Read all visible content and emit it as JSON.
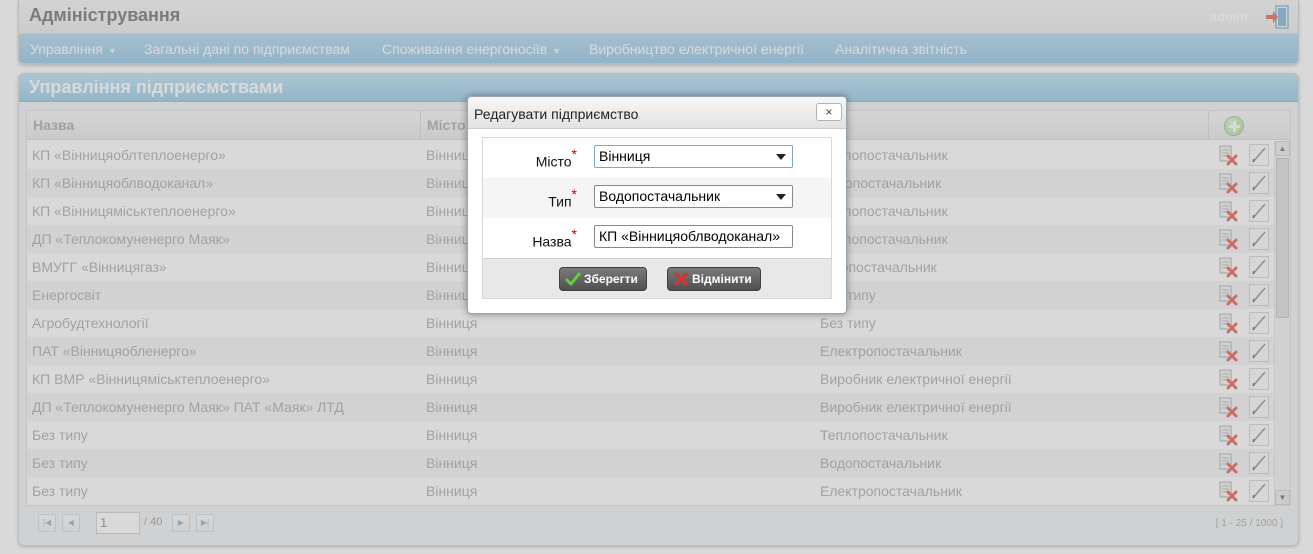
{
  "header": {
    "title": "Адміністрування",
    "user": "admin",
    "nav": [
      {
        "label": "Управління",
        "dropdown": true
      },
      {
        "label": "Загальні дані по підприємствам",
        "dropdown": false
      },
      {
        "label": "Споживання енергоносіїв",
        "dropdown": true
      },
      {
        "label": "Виробництво електричної енергії",
        "dropdown": false
      },
      {
        "label": "Аналітична звітність",
        "dropdown": false
      }
    ]
  },
  "panel": {
    "title": "Управління підприємствами",
    "columns": {
      "name": "Назва",
      "city": "Місто"
    },
    "rows": [
      {
        "name": "КП «Вінницяоблтеплоенерго»",
        "city": "Вінниця",
        "type": "Теплопостачальник"
      },
      {
        "name": "КП «Вінницяоблводоканал»",
        "city": "Вінниця",
        "type": "Водопостачальник"
      },
      {
        "name": "КП «Вінницяміськтеплоенерго»",
        "city": "Вінниця",
        "type": "Теплопостачальник"
      },
      {
        "name": "ДП «Теплокомуненерго Маяк»",
        "city": "Вінниця",
        "type": "Теплопостачальник"
      },
      {
        "name": "ВМУГГ «Вінницягаз»",
        "city": "Вінниця",
        "type": "Газопостачальник"
      },
      {
        "name": "Енергосвіт",
        "city": "Вінниця",
        "type": "Без типу"
      },
      {
        "name": "Агробудтехнології",
        "city": "Вінниця",
        "type": "Без типу"
      },
      {
        "name": "ПАТ «Вінницяобленерго»",
        "city": "Вінниця",
        "type": "Електропостачальник"
      },
      {
        "name": "КП ВМР «Вінницяміськтеплоенерго»",
        "city": "Вінниця",
        "type": "Виробник електричної енергії"
      },
      {
        "name": "ДП «Теплокомуненерго Маяк» ПАТ «Маяк» ЛТД",
        "city": "Вінниця",
        "type": "Виробник електричної енергії"
      },
      {
        "name": "Без типу",
        "city": "Вінниця",
        "type": "Теплопостачальник"
      },
      {
        "name": "Без типу",
        "city": "Вінниця",
        "type": "Водопостачальник"
      },
      {
        "name": "Без типу",
        "city": "Вінниця",
        "type": "Електропостачальник"
      }
    ],
    "pager": {
      "page": "1",
      "total": "/ 40",
      "info": "[ 1 - 25 / 1000 ]"
    }
  },
  "dialog": {
    "title": "Редагувати підприємство",
    "close_label": "×",
    "fields": {
      "city_label": "Місто",
      "city_value": "Вінниця",
      "type_label": "Тип",
      "type_value": "Водопостачальник",
      "name_label": "Назва",
      "name_value": "КП «Вінницяоблводоканал»",
      "required_mark": "*"
    },
    "save_label": "Зберегти",
    "cancel_label": "Відмінити"
  },
  "colors": {
    "accent": "#80c0e4",
    "required": "#cc0000"
  }
}
